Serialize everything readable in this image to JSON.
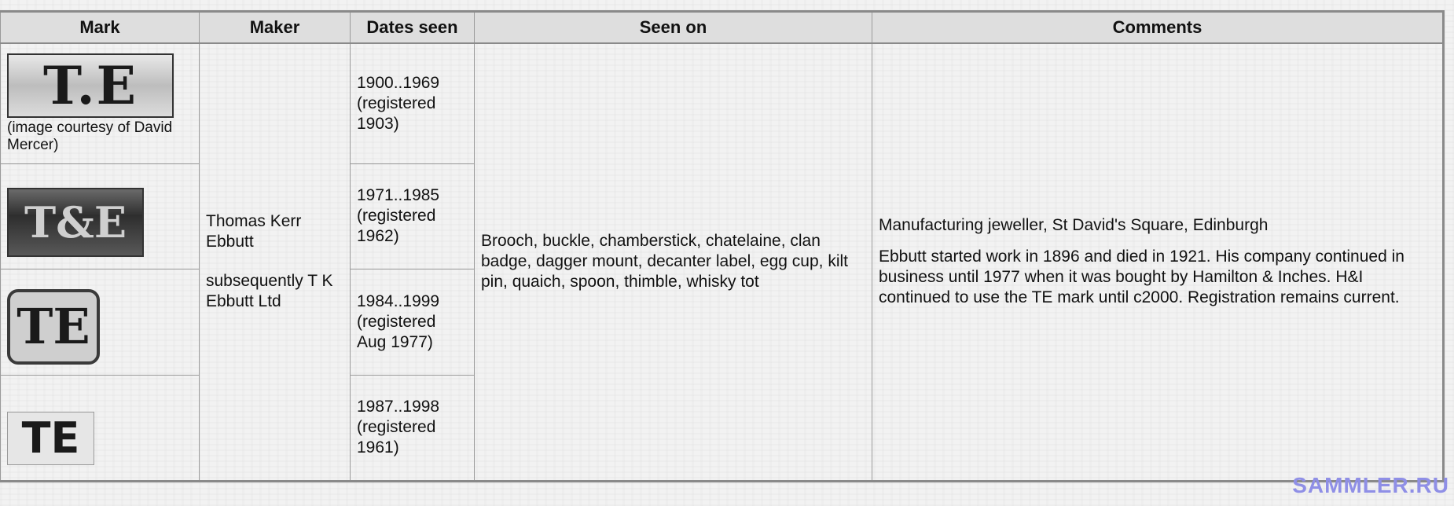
{
  "headers": {
    "mark": "Mark",
    "maker": "Maker",
    "dates": "Dates seen",
    "seen_on": "Seen on",
    "comments": "Comments"
  },
  "marks": [
    {
      "stamp": "T.E",
      "caption": "(image courtesy of David Mercer)",
      "dates": "1900..1969 (registered 1903)"
    },
    {
      "stamp": "T&E",
      "caption": "",
      "dates": "1971..1985 (registered 1962)"
    },
    {
      "stamp": "TE",
      "caption": "",
      "dates": "1984..1999 (registered Aug 1977)"
    },
    {
      "stamp": "TE",
      "caption": "",
      "dates": "1987..1998 (registered 1961)"
    }
  ],
  "maker": {
    "name": "Thomas Kerr Ebbutt",
    "later": "subsequently T K Ebbutt Ltd"
  },
  "seen_on": "Brooch, buckle, chamberstick, chatelaine, clan badge, dagger mount, decanter label, egg cup, kilt pin, quaich, spoon, thimble, whisky tot",
  "comments": {
    "line1": "Manufacturing jeweller, St David's Square, Edinburgh",
    "line2": "Ebbutt started work in 1896 and died in 1921. His company continued in business until 1977 when it was bought by Hamilton & Inches. H&I continued to use the TE mark until c2000. Registration remains current."
  },
  "watermark": "SAMMLER.RU"
}
